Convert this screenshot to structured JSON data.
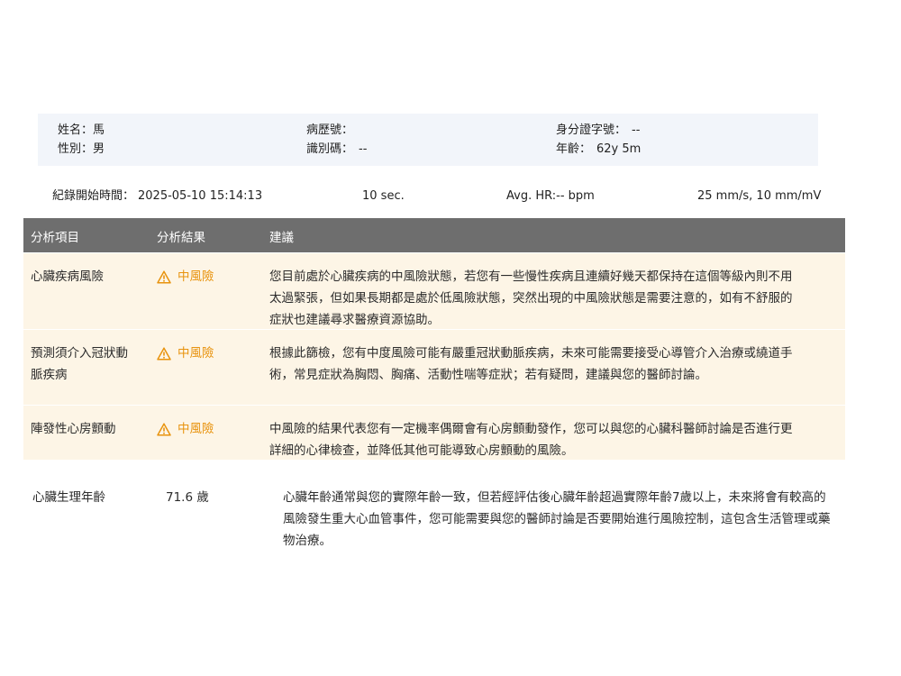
{
  "patient": {
    "name_label": "姓名：",
    "name_value": "馬",
    "gender_label": "性別：",
    "gender_value": "男",
    "record_no_label": "病歷號：",
    "record_no_value": "",
    "id_code_label": "識別碼：",
    "id_code_value": "--",
    "national_id_label": "身分證字號：",
    "national_id_value": "--",
    "age_label": "年齡：",
    "age_value": "62y 5m"
  },
  "record": {
    "start_label": "紀錄開始時間：",
    "start_value": "2025-05-10 15:14:13",
    "duration": "10 sec.",
    "avg_hr": "Avg. HR:-- bpm",
    "scale": "25 mm/s, 10 mm/mV"
  },
  "table": {
    "headers": [
      "分析項目",
      "分析結果",
      "建議"
    ],
    "rows": [
      {
        "item": "心臟疾病風險",
        "result": "中風險",
        "advice": "您目前處於心臟疾病的中風險狀態，若您有一些慢性疾病且連續好幾天都保持在這個等級內則不用太過緊張，但如果長期都是處於低風險狀態，突然出現的中風險狀態是需要注意的，如有不舒服的症狀也建議尋求醫療資源協助。"
      },
      {
        "item": "預測須介入冠狀動脈疾病",
        "result": "中風險",
        "advice": "根據此篩檢，您有中度風險可能有嚴重冠狀動脈疾病，未來可能需要接受心導管介入治療或繞道手術，常見症狀為胸悶、胸痛、活動性喘等症狀；若有疑問，建議與您的醫師討論。"
      },
      {
        "item": "陣發性心房顫動",
        "result": "中風險",
        "advice": "中風險的結果代表您有一定機率偶爾會有心房顫動發作，您可以與您的心臟科醫師討論是否進行更詳細的心律檢查，並降低其他可能導致心房顫動的風險。"
      }
    ]
  },
  "heart_age": {
    "label": "心臟生理年齡",
    "value": "71.6 歲",
    "advice": "心臟年齡通常與您的實際年齡一致，但若經評估後心臟年齡超過實際年齡7歲以上，未來將會有較高的風險發生重大心血管事件，您可能需要與您的醫師討論是否要開始進行風險控制，這包含生活管理或藥物治療。"
  },
  "colors": {
    "header_bg": "#6e6e6e",
    "row_bg": "#fdf5e6",
    "risk_color": "#e8930e",
    "patient_box_bg": "#f2f5fa"
  },
  "icons": {
    "risk": "warning-triangle-icon"
  }
}
